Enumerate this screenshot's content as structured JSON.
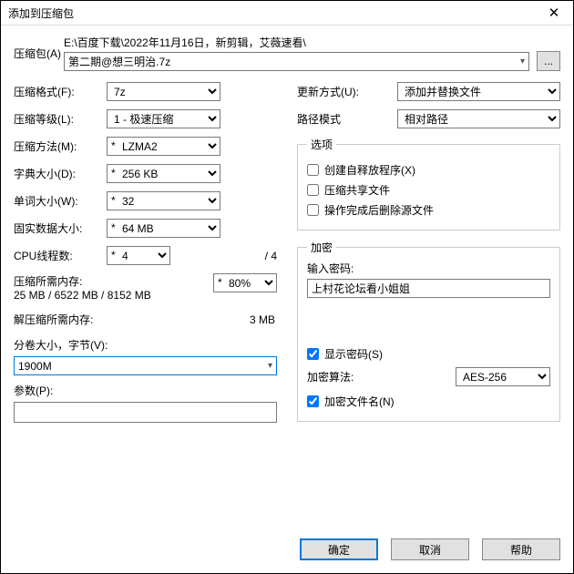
{
  "window": {
    "title": "添加到压缩包"
  },
  "archive": {
    "label": "压缩包(A)",
    "path_prefix": "E:\\百度下载\\2022年11月16日，新剪辑，艾薇速看\\",
    "filename": "第二期@想三明治.7z",
    "browse": "..."
  },
  "left": {
    "format": {
      "label": "压缩格式(F):",
      "value": "7z"
    },
    "level": {
      "label": "压缩等级(L):",
      "value": "1 - 极速压缩"
    },
    "method": {
      "label": "压缩方法(M):",
      "value": "LZMA2"
    },
    "dict": {
      "label": "字典大小(D):",
      "value": "256 KB"
    },
    "word": {
      "label": "单词大小(W):",
      "value": "32"
    },
    "solid": {
      "label": "固实数据大小:",
      "value": "64 MB"
    },
    "threads": {
      "label": "CPU线程数:",
      "value": "4",
      "suffix": "/ 4"
    },
    "memcomp": {
      "label": "压缩所需内存:",
      "detail": "25 MB / 6522 MB / 8152 MB",
      "pct": "80%"
    },
    "memdec": {
      "label": "解压缩所需内存:",
      "value": "3 MB"
    },
    "volume": {
      "label": "分卷大小，字节(V):",
      "value": "1900M"
    },
    "params": {
      "label": "参数(P):"
    }
  },
  "right": {
    "update": {
      "label": "更新方式(U):",
      "value": "添加并替换文件"
    },
    "pathmode": {
      "label": "路径模式",
      "value": "相对路径"
    },
    "options": {
      "legend": "选项",
      "sfx": "创建自释放程序(X)",
      "shared": "压缩共享文件",
      "delete": "操作完成后删除源文件"
    },
    "encrypt": {
      "legend": "加密",
      "pwdlabel": "输入密码:",
      "password": "上村花论坛看小姐姐",
      "showpwd": "显示密码(S)",
      "method_label": "加密算法:",
      "method": "AES-256",
      "encnames": "加密文件名(N)"
    }
  },
  "footer": {
    "ok": "确定",
    "cancel": "取消",
    "help": "帮助"
  }
}
